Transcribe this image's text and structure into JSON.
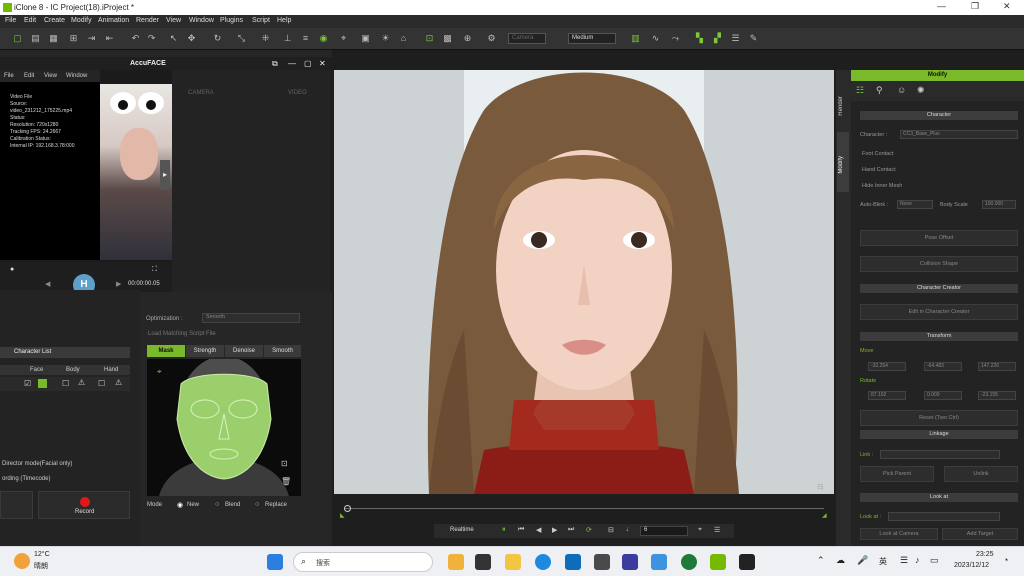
{
  "window": {
    "title": "iClone 8 - IC Project(18).iProject *"
  },
  "menubar": [
    "File",
    "Edit",
    "Create",
    "Modify",
    "Animation",
    "Render",
    "View",
    "Window",
    "Plugins",
    "Script",
    "Help"
  ],
  "toolbar": {
    "camera_dd": "Camera",
    "quality_dd": "Medium"
  },
  "accuface": {
    "title": "AccuFACE",
    "menu": [
      "File",
      "Edit",
      "View",
      "Window"
    ],
    "video_info": [
      "Video File",
      "Source:",
      "video_231212_175225.mp4",
      "Status:",
      "Resolution: 720x1280",
      "Tracking FPS: 24.2667",
      "Calibration Status:",
      "Internal IP: 192.168.3.78:000"
    ],
    "tabs": [
      "CAMERA",
      "VIDEO"
    ],
    "time": "00:00:00.05",
    "optimization_label": "Optimization :",
    "optimization_value": "Smooth",
    "load_label": "Load Matching Script File"
  },
  "mask_tabs": [
    "Mask",
    "Strength",
    "Denoise",
    "Smooth"
  ],
  "mask_mode": {
    "label": "Mode",
    "options": [
      "New",
      "Blend",
      "Replace"
    ]
  },
  "character_list": {
    "title": "Character List",
    "headers": [
      "Face",
      "Body",
      "Hand"
    ]
  },
  "director_mode": "Director mode(Facial only)",
  "recording": "ording (Timecode)",
  "record_label": "Record",
  "viewport_bar": {
    "mode": "Realtime",
    "frame": "6"
  },
  "modify": {
    "title": "Modify",
    "side_tabs": [
      "Render",
      "Modify"
    ],
    "sections": {
      "character": "Character",
      "creator": "Character Creator",
      "transform": "Transform",
      "linkage": "Linkage",
      "lookat": "Look at"
    },
    "character_label": "Character :",
    "character_value": "CC3_Base_Plus",
    "checks": [
      "Foot Contact",
      "Hand Contact",
      "Hide Inner Mesh"
    ],
    "auto_blink_label": "Auto-Blink :",
    "auto_blink_value": "None",
    "body_scale_label": "Body Scale",
    "body_scale_value": "100.000",
    "pose_offset": "Pose Offset",
    "collision_shape": "Collision Shape",
    "edit_cc": "Edit in Character Creator",
    "move_label": "Move",
    "move": {
      "x": "-32.254",
      "y": "-64.483",
      "z": "147.226"
    },
    "rotate_label": "Rotate",
    "rotate": {
      "x": "87.102",
      "y": "0.000",
      "z": "-23.155"
    },
    "reset": "Reset (Two Ctrl)",
    "link_label": "Link :",
    "pick_parent": "Pick Parent",
    "unlink": "Unlink",
    "lookat_label": "Look at :",
    "lookat_camera": "Look at Camera",
    "add_target": "Add Target"
  },
  "taskbar": {
    "weather_temp": "12°C",
    "weather_desc": "晴朗",
    "search_placeholder": "搜索",
    "lang": "英",
    "time": "23:25",
    "date": "2023/12/12"
  }
}
